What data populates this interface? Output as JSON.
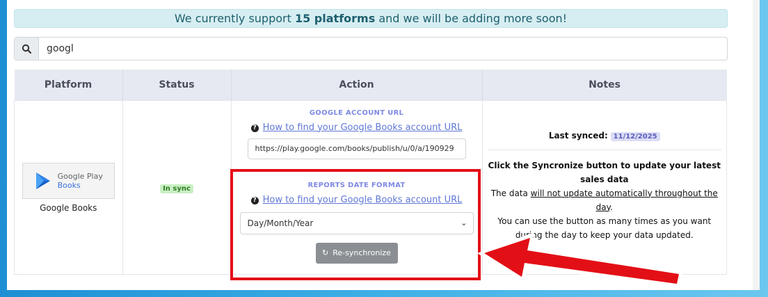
{
  "banner": {
    "prefix": "We currently support ",
    "bold": "15 platforms",
    "suffix": " and we will be adding more soon!"
  },
  "search": {
    "value": "googl"
  },
  "table": {
    "headers": [
      "Platform",
      "Status",
      "Action",
      "Notes"
    ],
    "row": {
      "platform": {
        "logo_line1": "Google Play",
        "logo_line2": "Books",
        "name": "Google Books"
      },
      "status": "In sync",
      "action": {
        "account_label": "GOOGLE ACCOUNT URL",
        "account_help": "How to find your Google Books account URL",
        "account_value": "https://play.google.com/books/publish/u/0/a/190929",
        "date_label": "REPORTS DATE FORMAT",
        "date_help": "How to find your Google Books account URL",
        "date_value": "Day/Month/Year",
        "resync_label": "Re-synchronize"
      },
      "notes": {
        "last_synced_label": "Last synced:",
        "last_synced_date": "11/12/2025",
        "line1": "Click the Syncronize button to update your latest sales data",
        "line2_pre": "The data ",
        "line2_u": "will not update automatically throughout the day",
        "line2_post": ".",
        "line3": "You can use the button as many times as you want during the day to keep your data updated."
      }
    }
  },
  "colors": {
    "highlight": "#e30f16",
    "accent": "#7f8ae4",
    "link": "#5f77d6",
    "status_bg": "#c9efc3"
  },
  "icons": [
    "search-icon",
    "question-icon",
    "chevron-down-icon",
    "sync-icon",
    "google-play-icon",
    "red-arrow-icon"
  ]
}
